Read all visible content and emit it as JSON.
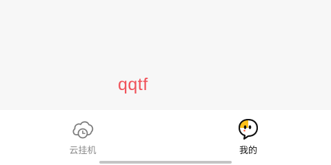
{
  "profile": {
    "username": "qqtf"
  },
  "tabbar": {
    "tabs": [
      {
        "label": "云挂机",
        "icon": "cloud-clock-icon",
        "active": false
      },
      {
        "label": "我的",
        "icon": "mascot-face-icon",
        "active": true
      }
    ]
  },
  "colors": {
    "username": "#f0525a",
    "tab_inactive": "#8a8a8a",
    "tab_active": "#111111",
    "mascot_yellow": "#ffc21a",
    "background": "#f7f7f7"
  }
}
